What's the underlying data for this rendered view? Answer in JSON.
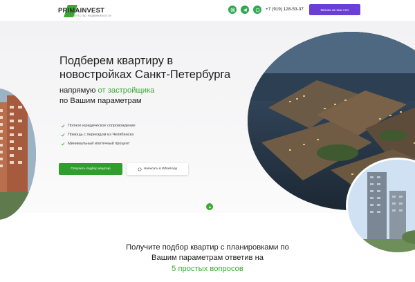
{
  "header": {
    "logo_text_a": "PRIMA",
    "logo_text_b": "INVEST",
    "logo_tagline": "АГЕНТСТВО НЕДВИЖИМОСТИ",
    "phone": "+7 (919) 128-53-37",
    "call_button_label": "Звонок за наш счет",
    "social_icons": [
      "instagram-icon",
      "telegram-icon",
      "whatsapp-icon"
    ]
  },
  "hero": {
    "title": "Подберем квартиру в новостройках Санкт-Петербурга",
    "subtitle_prefix": "напрямую ",
    "subtitle_accent": "от застройщика",
    "subtitle_line2": "по Вашим параметрам",
    "features": [
      "Полное юридическое сопровождение",
      "Помощь с переездом из Челябинска",
      "Минимальный ипотечный процент"
    ],
    "primary_button_label": "Получить подбор квартир",
    "whatsapp_button_label": "Написать в WhatsApp"
  },
  "quiz": {
    "title": "Получите подбор квартир с планировками по Вашим параметрам ответив на",
    "accent": "5 простых вопросов"
  },
  "colors": {
    "accent_green": "#3aa935",
    "button_green": "#2e9e2c",
    "call_purple": "#6a3fd6"
  }
}
